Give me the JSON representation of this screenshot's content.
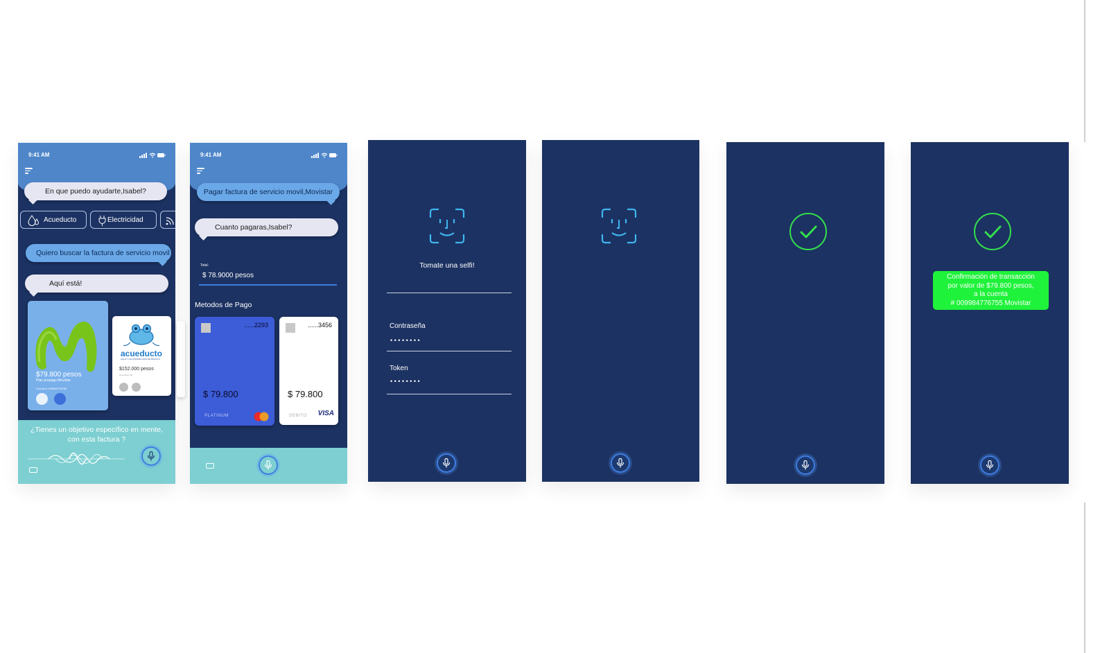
{
  "status_bar": {
    "time": "9:41 AM"
  },
  "screen1": {
    "greeting": "En que puedo ayudarte,Isabel?",
    "chips": [
      "Acueducto",
      "Electricidad"
    ],
    "user_message": "Quiero buscar la factura de servicio movil",
    "reply": "Aquí está!",
    "bill_movistar": {
      "amount": "$79.800 pesos",
      "plan": "Plan prepago Movistar",
      "account": "Cuenta # 009984776755"
    },
    "bill_acueducto": {
      "logo_text": "acueducto",
      "logo_sub": "AGUA Y ALCANTARILLADO DE BOGOTÁ",
      "amount": "$152.000 pesos",
      "note": "Acueducto AB"
    },
    "question_line1": "¿Tienes un objetivo específico en mente,",
    "question_line2": "con esta factura ?"
  },
  "screen2": {
    "user_message": "Pagar factura de servicio movil,Movistar",
    "question": "Cuanto pagaras,Isabel?",
    "total_label": "Total:",
    "total_value": "$ 78.9000 pesos",
    "methods_title": "Metodos de Pago",
    "cards": [
      {
        "number": "......2293",
        "amount": "$ 79.800",
        "tier": "PLATINUM",
        "brand": "mastercard"
      },
      {
        "number": "......3456",
        "amount": "$ 79.800",
        "tier": "DEBITO",
        "brand": "VISA"
      }
    ]
  },
  "screen3": {
    "prompt": "Tomate una selfi!",
    "password_label": "Contraseña",
    "password_value": "••••••••",
    "token_label": "Token",
    "token_value": "••••••••"
  },
  "screen6": {
    "confirm_line1": "Confirmación de transacción",
    "confirm_line2": "por valor de $79.800 pesos,",
    "confirm_line3": "a la cuenta",
    "confirm_line4": "# 009984776755 Movistar"
  },
  "colors": {
    "navy": "#1c3262",
    "header_blue": "#4e86c9",
    "teal": "#7dcfd1",
    "success": "#33e04d",
    "face_cyan": "#3fb6f0"
  },
  "icons": [
    "menu-icon",
    "water-drop-icon",
    "plug-icon",
    "wifi-icon",
    "microphone-icon",
    "keyboard-icon",
    "face-id-icon",
    "check-icon",
    "mastercard-icon",
    "visa-logo"
  ]
}
